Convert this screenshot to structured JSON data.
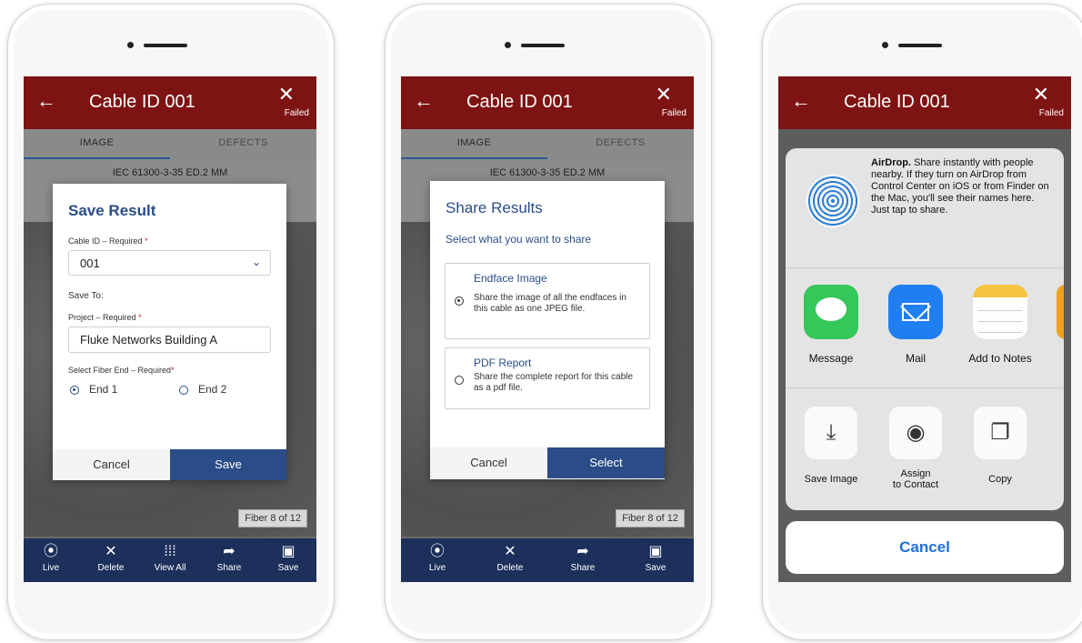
{
  "phones": [
    {
      "header": {
        "title": "Cable ID 001",
        "status": "Failed",
        "back_icon": "←",
        "close_icon": "✕"
      },
      "tabs": {
        "image": "IMAGE",
        "defects": "DEFECTS"
      },
      "standard_label": "IEC 61300-3-35 ED.2 MM",
      "fiber_label": "Fiber 8 of 12",
      "bottom_nav": [
        {
          "icon": "live-icon",
          "glyph": "⦿",
          "label": "Live"
        },
        {
          "icon": "delete-icon",
          "glyph": "✕",
          "label": "Delete"
        },
        {
          "icon": "view-all-icon",
          "glyph": "⁞⁞⁞",
          "label": "View All"
        },
        {
          "icon": "share-icon",
          "glyph": "➦",
          "label": "Share"
        },
        {
          "icon": "save-icon",
          "glyph": "▣",
          "label": "Save"
        }
      ],
      "dialog": {
        "title": "Save Result",
        "cable_id_label": "Cable ID – Required",
        "cable_id_value": "001",
        "save_to_label": "Save To:",
        "project_label": "Project – Required",
        "project_value": "Fluke Networks Building A",
        "fiber_end_label": "Select Fiber End – Required",
        "end1": "End 1",
        "end2": "End 2",
        "selected_end": "End 1",
        "cancel": "Cancel",
        "save": "Save"
      }
    },
    {
      "header": {
        "title": "Cable ID 001",
        "status": "Failed",
        "back_icon": "←",
        "close_icon": "✕"
      },
      "tabs": {
        "image": "IMAGE",
        "defects": "DEFECTS"
      },
      "standard_label": "IEC 61300-3-35 ED.2 MM",
      "fiber_label": "Fiber 8 of 12",
      "bottom_nav": [
        {
          "icon": "live-icon",
          "glyph": "⦿",
          "label": "Live"
        },
        {
          "icon": "delete-icon",
          "glyph": "✕",
          "label": "Delete"
        },
        {
          "icon": "share-icon",
          "glyph": "➦",
          "label": "Share"
        },
        {
          "icon": "save-icon",
          "glyph": "▣",
          "label": "Save"
        }
      ],
      "dialog": {
        "title": "Share Results",
        "subtitle": "Select what you want to share",
        "option1_title": "Endface Image",
        "option1_desc": "Share the image of all the endfaces in this cable as one JPEG file.",
        "option2_title": "PDF Report",
        "option2_desc": "Share the complete report for this cable as a pdf file.",
        "selected_option": "Endface Image",
        "cancel": "Cancel",
        "select": "Select"
      }
    },
    {
      "header": {
        "title": "Cable ID 001",
        "status": "Failed",
        "back_icon": "←",
        "close_icon": "✕"
      },
      "share_sheet": {
        "airdrop_title": "AirDrop.",
        "airdrop_text": "Share instantly with people nearby. If they turn on AirDrop from Control Center on iOS or from Finder on the Mac, you'll see their names here. Just tap to share.",
        "apps": [
          {
            "label": "Message",
            "icon": "message-icon",
            "color": "#34c759"
          },
          {
            "label": "Mail",
            "icon": "mail-icon",
            "color": "#1f7ef0"
          },
          {
            "label": "Add to Notes",
            "icon": "notes-icon",
            "color": "#f5c542"
          }
        ],
        "actions": [
          {
            "label": "Save Image",
            "icon": "save-image-icon",
            "glyph": "⤓"
          },
          {
            "label": "Assign\nto Contact",
            "icon": "contact-icon",
            "glyph": "◉"
          },
          {
            "label": "Copy",
            "icon": "copy-icon",
            "glyph": "❐"
          }
        ],
        "cancel": "Cancel"
      }
    }
  ],
  "colors": {
    "header": "#7e1313",
    "nav": "#1d2f5b",
    "accent": "#2a4d87",
    "ios_blue": "#1f6fdc"
  }
}
